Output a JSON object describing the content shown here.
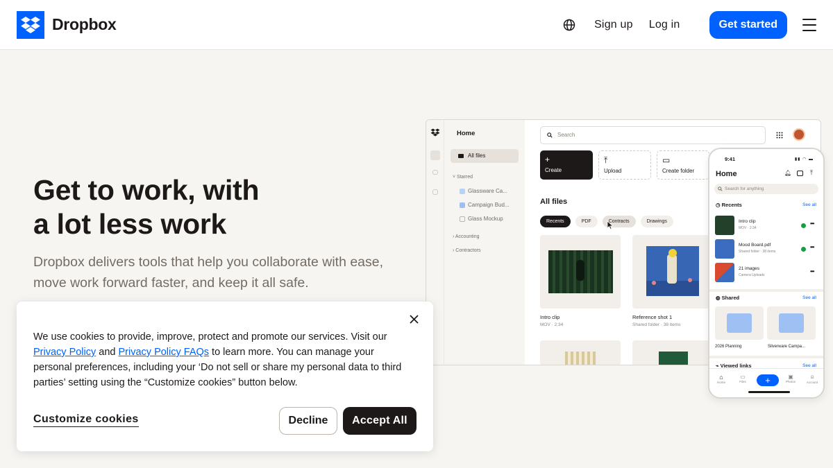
{
  "brand": {
    "name": "Dropbox",
    "color": "#0061fe"
  },
  "nav": {
    "sign_up": "Sign up",
    "log_in": "Log in",
    "get_started": "Get started",
    "globe_icon": "globe-icon",
    "menu_icon": "hamburger-menu-icon"
  },
  "hero": {
    "title_line1": "Get to work, with",
    "title_line2": "a lot less work",
    "subtitle": "Dropbox delivers tools that help you collaborate with ease, move work forward faster, and keep it all safe."
  },
  "desktop_mock": {
    "sidebar": {
      "home": "Home",
      "all_files": "All files",
      "starred": "Starred",
      "starred_items": [
        "Glassware Ca...",
        "Campaign Bud...",
        "Glass Mockup"
      ],
      "accounting": "Accounting",
      "contractors": "Contractors"
    },
    "search_placeholder": "Search",
    "actions": {
      "create": "Create",
      "upload": "Upload",
      "create_folder": "Create folder"
    },
    "all_files_heading": "All files",
    "chips": [
      "Recents",
      "PDF",
      "Contracts",
      "Drawings"
    ],
    "files": [
      {
        "name": "Intro clip",
        "meta": "MOV · 2:34"
      },
      {
        "name": "Reference shot 1",
        "meta": "Shared folder · 38 items"
      }
    ]
  },
  "phone_mock": {
    "time": "9:41",
    "home": "Home",
    "search_placeholder": "Search for anything",
    "recents": "Recents",
    "see_all": "See all",
    "recent_items": [
      {
        "name": "Intro clip",
        "meta": "MOV · 2:34"
      },
      {
        "name": "Mood Board.pdf",
        "meta": "Shared folder · 38 items"
      },
      {
        "name": "21 images",
        "meta": "Camera Uploads"
      }
    ],
    "shared": "Shared",
    "shared_items": [
      "2026 Planning",
      "Silverware Campa..."
    ],
    "viewed_links": "Viewed links",
    "tabs": [
      "Home",
      "Files",
      "Photos",
      "Account"
    ]
  },
  "cookie": {
    "text_pre": "We use cookies to provide, improve, protect and promote our services. Visit our ",
    "privacy_policy": "Privacy Policy",
    "and": " and ",
    "privacy_faqs": "Privacy Policy FAQs",
    "text_post": " to learn more. You can manage your personal preferences, including your ‘Do not sell or share my personal data to third parties’ setting using the “Customize cookies” button below.",
    "customize": "Customize cookies",
    "decline": "Decline",
    "accept_all": "Accept All"
  }
}
